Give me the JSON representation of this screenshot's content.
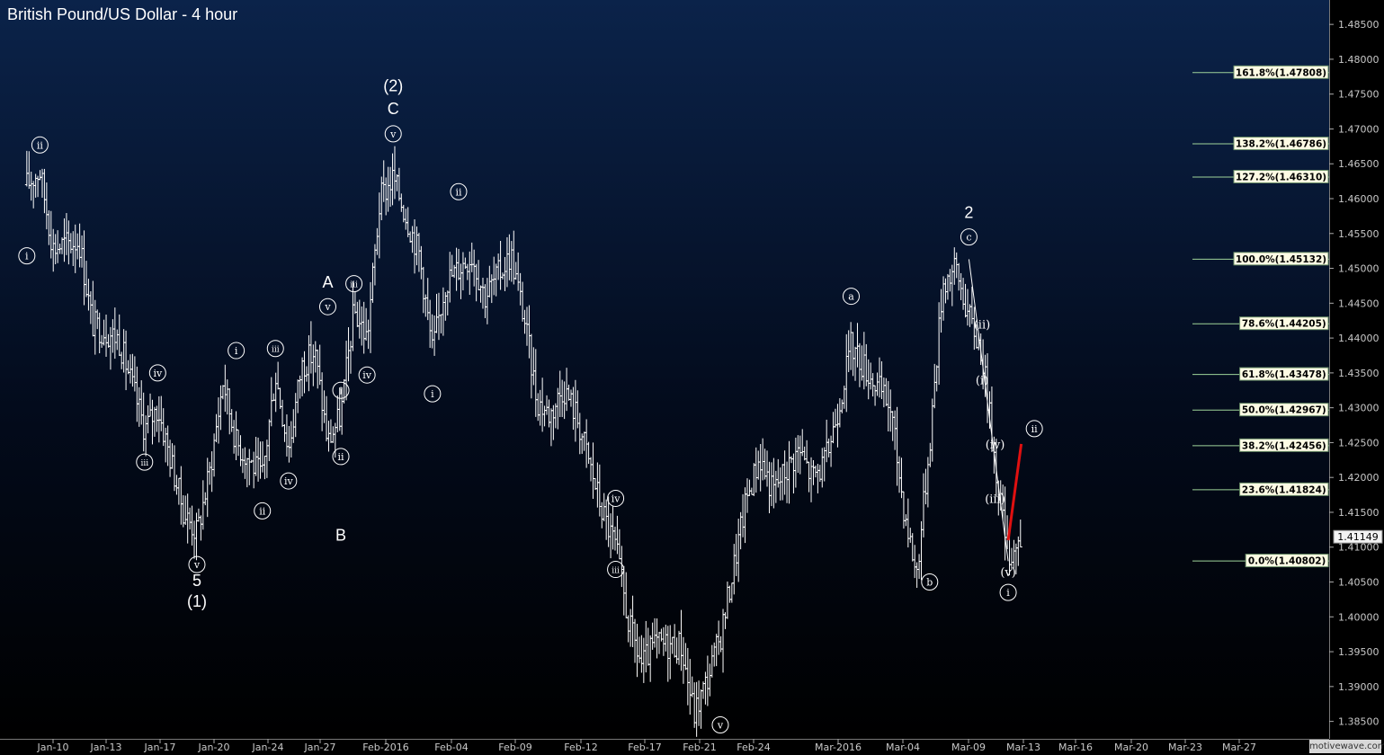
{
  "header": {
    "title": "British Pound/US Dollar - 4 hour"
  },
  "watermark": "motivewave.com",
  "colors": {
    "bg_top": "#0b234a",
    "bg_bottom": "#000000",
    "bars": "#ffffff",
    "fib_line": "#9fd49a",
    "fib_box_bg": "#fdfbe4",
    "projection": "#e01010",
    "price_box_bg": "#f3f3f3"
  },
  "chart_data": {
    "type": "ohlc",
    "title": "British Pound/US Dollar - 4 hour",
    "y_axis": {
      "ylim": [
        1.3825,
        1.4885
      ],
      "side": "right",
      "ticks": [
        "1.48500",
        "1.48000",
        "1.47500",
        "1.47000",
        "1.46500",
        "1.46000",
        "1.45500",
        "1.45000",
        "1.44500",
        "1.44000",
        "1.43500",
        "1.43000",
        "1.42500",
        "1.42000",
        "1.41500",
        "1.41000",
        "1.40500",
        "1.40000",
        "1.39500",
        "1.39000",
        "1.38500"
      ]
    },
    "x_axis": {
      "labels": [
        "Jan-10",
        "Jan-13",
        "Jan-17",
        "Jan-20",
        "Jan-24",
        "Jan-27",
        "Feb-2016",
        "Feb-04",
        "Feb-09",
        "Feb-12",
        "Feb-17",
        "Feb-21",
        "Feb-24",
        "Mar-2016",
        "Mar-04",
        "Mar-09",
        "Mar-13",
        "Mar-16",
        "Mar-20",
        "Mar-23",
        "Mar-27"
      ]
    },
    "anchors": [
      {
        "date": "Jan-08",
        "close": 1.462
      },
      {
        "date": "Jan-09",
        "close": 1.464
      },
      {
        "date": "Jan-10",
        "close": 1.453
      },
      {
        "date": "Jan-12",
        "close": 1.454
      },
      {
        "date": "Jan-13",
        "close": 1.442
      },
      {
        "date": "Jan-15",
        "close": 1.44
      },
      {
        "date": "Jan-17",
        "close": 1.427
      },
      {
        "date": "Jan-18",
        "close": 1.43
      },
      {
        "date": "Jan-20",
        "close": 1.415
      },
      {
        "date": "Jan-21",
        "close": 1.412
      },
      {
        "date": "Jan-22",
        "close": 1.421
      },
      {
        "date": "Jan-23",
        "close": 1.434
      },
      {
        "date": "Jan-24",
        "close": 1.425
      },
      {
        "date": "Jan-26",
        "close": 1.42
      },
      {
        "date": "Jan-27",
        "close": 1.435
      },
      {
        "date": "Jan-28",
        "close": 1.424
      },
      {
        "date": "Jan-29",
        "close": 1.436
      },
      {
        "date": "Jan-30",
        "close": 1.438
      },
      {
        "date": "Jan-31",
        "close": 1.425
      },
      {
        "date": "Feb-01",
        "close": 1.429
      },
      {
        "date": "Feb-02",
        "close": 1.444
      },
      {
        "date": "Feb-03",
        "close": 1.44
      },
      {
        "date": "Feb-04",
        "close": 1.46
      },
      {
        "date": "Feb-05",
        "close": 1.463
      },
      {
        "date": "Feb-07",
        "close": 1.452
      },
      {
        "date": "Feb-08",
        "close": 1.438
      },
      {
        "date": "Feb-09",
        "close": 1.448
      },
      {
        "date": "Feb-10",
        "close": 1.45
      },
      {
        "date": "Feb-11",
        "close": 1.452
      },
      {
        "date": "Feb-12",
        "close": 1.446
      },
      {
        "date": "Feb-14",
        "close": 1.452
      },
      {
        "date": "Feb-15",
        "close": 1.443
      },
      {
        "date": "Feb-16",
        "close": 1.431
      },
      {
        "date": "Feb-17",
        "close": 1.429
      },
      {
        "date": "Feb-18",
        "close": 1.433
      },
      {
        "date": "Feb-19",
        "close": 1.429
      },
      {
        "date": "Feb-21",
        "close": 1.415
      },
      {
        "date": "Feb-22",
        "close": 1.41
      },
      {
        "date": "Feb-23",
        "close": 1.399
      },
      {
        "date": "Feb-24",
        "close": 1.393
      },
      {
        "date": "Feb-25",
        "close": 1.396
      },
      {
        "date": "Feb-27",
        "close": 1.396
      },
      {
        "date": "Feb-28",
        "close": 1.386
      },
      {
        "date": "Feb-29",
        "close": 1.391
      },
      {
        "date": "Mar-01",
        "close": 1.397
      },
      {
        "date": "Mar-02",
        "close": 1.407
      },
      {
        "date": "Mar-03",
        "close": 1.417
      },
      {
        "date": "Mar-04",
        "close": 1.423
      },
      {
        "date": "Mar-05",
        "close": 1.418
      },
      {
        "date": "Mar-07",
        "close": 1.424
      },
      {
        "date": "Mar-08",
        "close": 1.42
      },
      {
        "date": "Mar-09",
        "close": 1.422
      },
      {
        "date": "Mar-10",
        "close": 1.43
      },
      {
        "date": "Mar-11",
        "close": 1.439
      },
      {
        "date": "Mar-12",
        "close": 1.436
      },
      {
        "date": "Mar-14",
        "close": 1.43
      },
      {
        "date": "Mar-15",
        "close": 1.416
      },
      {
        "date": "Mar-16",
        "close": 1.406
      },
      {
        "date": "Mar-17",
        "close": 1.425
      },
      {
        "date": "Mar-18",
        "close": 1.448
      },
      {
        "date": "Mar-19",
        "close": 1.45
      },
      {
        "date": "Mar-20",
        "close": 1.443
      },
      {
        "date": "Mar-21",
        "close": 1.438
      },
      {
        "date": "Mar-22",
        "close": 1.422
      },
      {
        "date": "Mar-23",
        "close": 1.409
      },
      {
        "date": "Mar-24",
        "close": 1.411
      }
    ],
    "current_price": "1.41149",
    "fib_levels": [
      {
        "label": "161.8%(1.47808)",
        "price": 1.47808
      },
      {
        "label": "138.2%(1.46786)",
        "price": 1.46786
      },
      {
        "label": "127.2%(1.46310)",
        "price": 1.4631
      },
      {
        "label": "100.0%(1.45132)",
        "price": 1.45132
      },
      {
        "label": "78.6%(1.44205)",
        "price": 1.44205
      },
      {
        "label": "61.8%(1.43478)",
        "price": 1.43478
      },
      {
        "label": "50.0%(1.42967)",
        "price": 1.42967
      },
      {
        "label": "38.2%(1.42456)",
        "price": 1.42456
      },
      {
        "label": "23.6%(1.41824)",
        "price": 1.41824
      },
      {
        "label": "0.0%(1.40802)",
        "price": 1.40802
      }
    ],
    "wave_labels": [
      {
        "text": "ii",
        "style": "circle",
        "date": "Jan-09",
        "price": 1.4677
      },
      {
        "text": "i",
        "style": "circle",
        "date": "Jan-08",
        "price": 1.4518
      },
      {
        "text": "iv",
        "style": "circle",
        "date": "Jan-18",
        "price": 1.435
      },
      {
        "text": "iii",
        "style": "circle",
        "date": "Jan-17",
        "price": 1.4222
      },
      {
        "text": "v",
        "style": "circle",
        "date": "Jan-21",
        "price": 1.4075
      },
      {
        "text": "5",
        "style": "plain",
        "date": "Jan-21",
        "price": 1.4052
      },
      {
        "text": "(1)",
        "style": "plain",
        "date": "Jan-21",
        "price": 1.4022
      },
      {
        "text": "i",
        "style": "circle",
        "date": "Jan-24",
        "price": 1.4382
      },
      {
        "text": "ii",
        "style": "circle",
        "date": "Jan-26",
        "price": 1.4152
      },
      {
        "text": "iii",
        "style": "circle",
        "date": "Jan-27",
        "price": 1.4385
      },
      {
        "text": "iv",
        "style": "circle",
        "date": "Jan-28",
        "price": 1.4195
      },
      {
        "text": "v",
        "style": "circle",
        "date": "Jan-31",
        "price": 1.4445
      },
      {
        "text": "A",
        "style": "plain",
        "date": "Jan-31",
        "price": 1.448
      },
      {
        "text": "B",
        "style": "plain",
        "date": "Feb-01",
        "price": 1.4117
      },
      {
        "text": "i",
        "style": "circle",
        "date": "Feb-01",
        "price": 1.4325
      },
      {
        "text": "ii",
        "style": "circle",
        "date": "Feb-01",
        "price": 1.423
      },
      {
        "text": "iii",
        "style": "circle",
        "date": "Feb-02",
        "price": 1.4478
      },
      {
        "text": "iv",
        "style": "circle",
        "date": "Feb-03",
        "price": 1.4347
      },
      {
        "text": "v",
        "style": "circle",
        "date": "Feb-05",
        "price": 1.4693
      },
      {
        "text": "C",
        "style": "plain",
        "date": "Feb-05",
        "price": 1.4729
      },
      {
        "text": "(2)",
        "style": "plain",
        "date": "Feb-05",
        "price": 1.4762
      },
      {
        "text": "i",
        "style": "circle",
        "date": "Feb-08",
        "price": 1.432
      },
      {
        "text": "ii",
        "style": "circle",
        "date": "Feb-10",
        "price": 1.461
      },
      {
        "text": "iv",
        "style": "circle",
        "date": "Feb-22",
        "price": 1.417
      },
      {
        "text": "iii",
        "style": "circle",
        "date": "Feb-22",
        "price": 1.4068
      },
      {
        "text": "v",
        "style": "circle",
        "date": "Mar-01",
        "price": 1.3845
      },
      {
        "text": "a",
        "style": "circle",
        "date": "Mar-11",
        "price": 1.446
      },
      {
        "text": "b",
        "style": "circle",
        "date": "Mar-17",
        "price": 1.405
      },
      {
        "text": "c",
        "style": "circle",
        "date": "Mar-20",
        "price": 1.4545
      },
      {
        "text": "2",
        "style": "plain",
        "date": "Mar-20",
        "price": 1.458
      },
      {
        "text": "(ii)",
        "style": "paren",
        "date": "Mar-21",
        "price": 1.442
      },
      {
        "text": "(i)",
        "style": "paren",
        "date": "Mar-21",
        "price": 1.434
      },
      {
        "text": "(iv)",
        "style": "paren",
        "date": "Mar-22",
        "price": 1.4248
      },
      {
        "text": "(iii)",
        "style": "paren",
        "date": "Mar-22",
        "price": 1.417
      },
      {
        "text": "(v)",
        "style": "paren",
        "date": "Mar-23",
        "price": 1.4065
      },
      {
        "text": "i",
        "style": "circle",
        "date": "Mar-23",
        "price": 1.4035
      },
      {
        "text": "ii",
        "style": "circle",
        "date": "Mar-25",
        "price": 1.427
      }
    ],
    "trend_lines": [
      {
        "from": {
          "date": "Mar-20",
          "price": 1.4513
        },
        "to": {
          "date": "Mar-23",
          "price": 1.408
        },
        "color": "#ffffff"
      },
      {
        "from": {
          "date": "Mar-23",
          "price": 1.411
        },
        "to": {
          "date": "Mar-24",
          "price": 1.4248
        },
        "color": "#e01010"
      }
    ]
  }
}
